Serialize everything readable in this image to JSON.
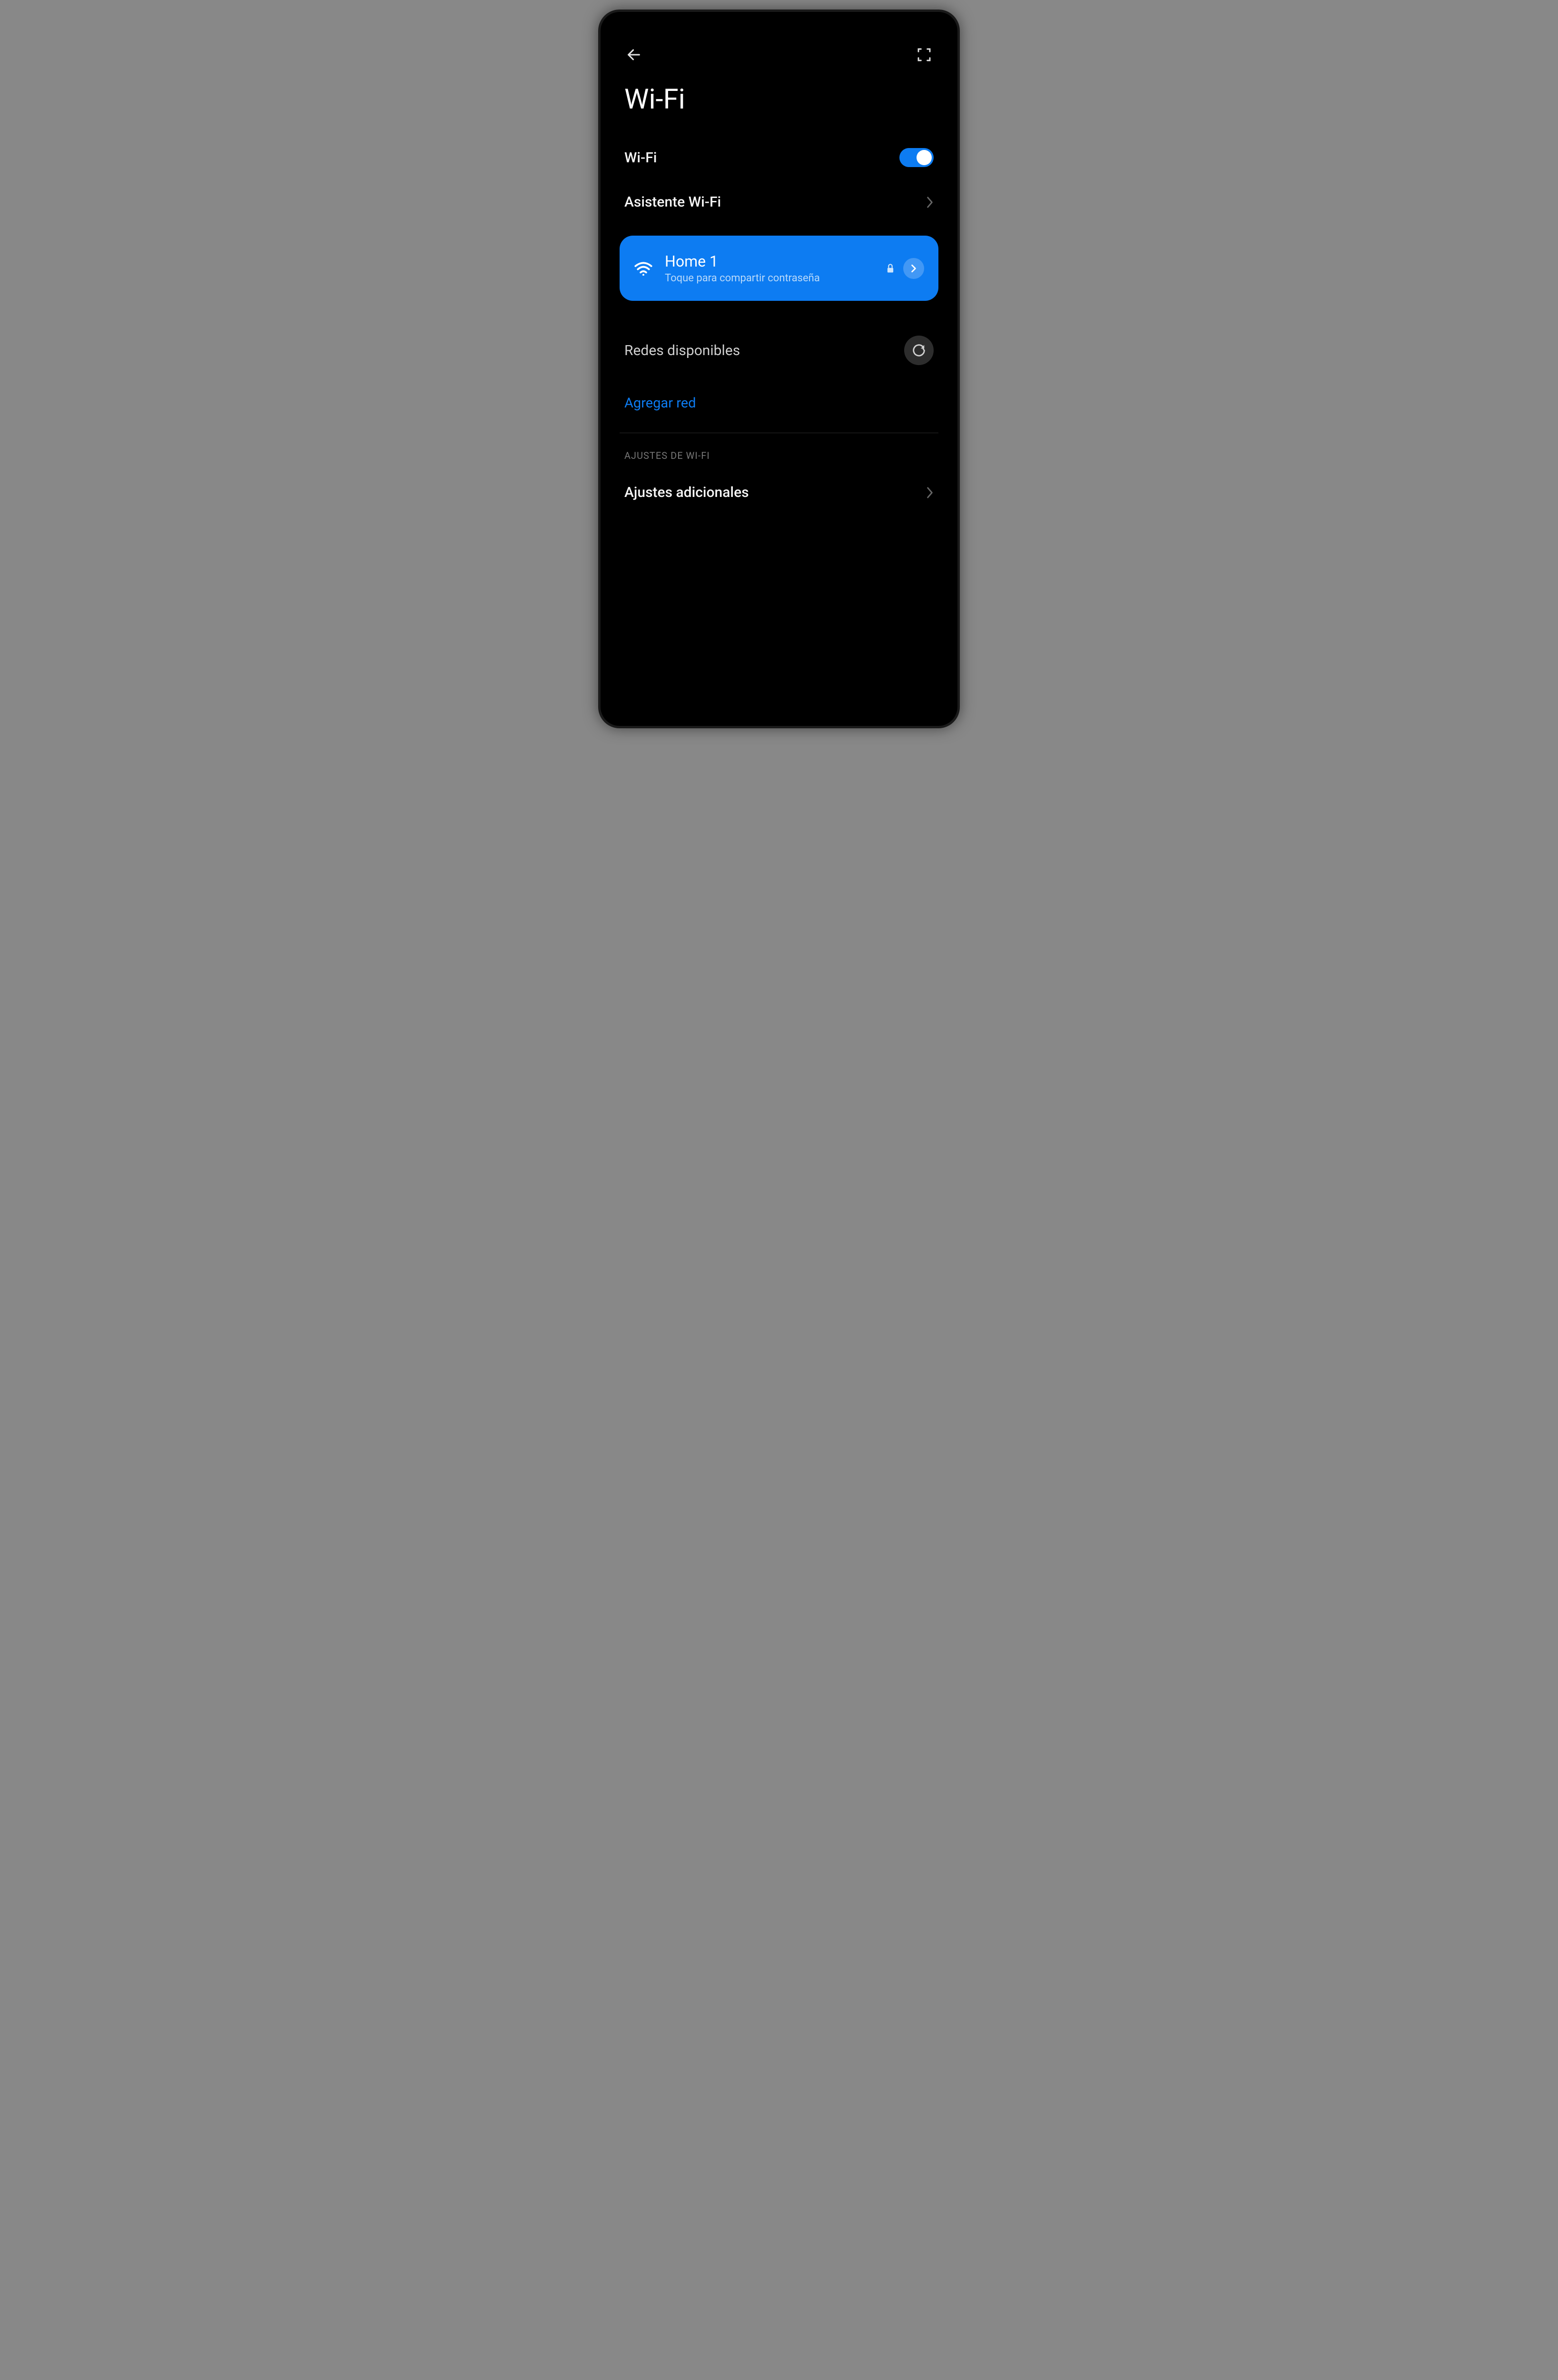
{
  "page": {
    "title": "Wi-Fi"
  },
  "toggle": {
    "label": "Wi-Fi",
    "enabled": true
  },
  "assistant": {
    "label": "Asistente Wi-Fi"
  },
  "connected": {
    "ssid": "Home 1",
    "subtitle": "Toque para compartir contraseña"
  },
  "networks": {
    "header": "Redes disponibles",
    "add_link": "Agregar red"
  },
  "settings_section": {
    "header": "AJUSTES DE WI-FI",
    "additional": "Ajustes adicionales"
  }
}
